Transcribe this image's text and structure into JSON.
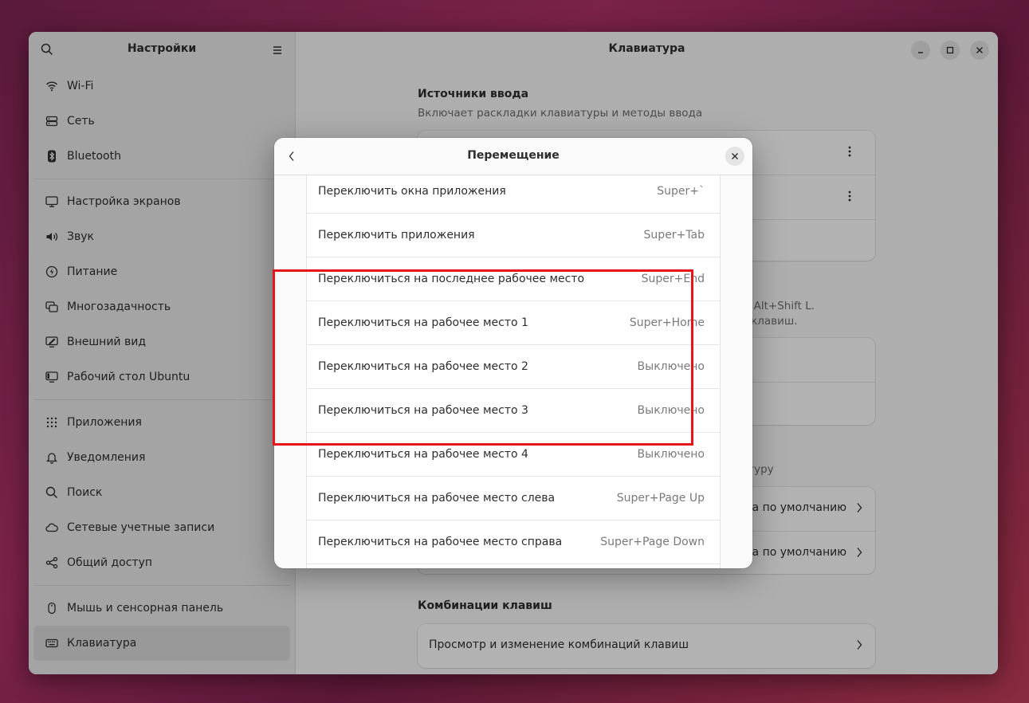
{
  "sidebar": {
    "title": "Настройки",
    "groups": [
      [
        {
          "label": "Wi-Fi",
          "icon": "wifi-icon"
        },
        {
          "label": "Сеть",
          "icon": "network-icon"
        },
        {
          "label": "Bluetooth",
          "icon": "bluetooth-icon"
        }
      ],
      [
        {
          "label": "Настройка экранов",
          "icon": "display-icon"
        },
        {
          "label": "Звук",
          "icon": "speaker-icon"
        },
        {
          "label": "Питание",
          "icon": "power-icon"
        },
        {
          "label": "Многозадачность",
          "icon": "multitasking-icon"
        },
        {
          "label": "Внешний вид",
          "icon": "appearance-icon"
        },
        {
          "label": "Рабочий стол Ubuntu",
          "icon": "ubuntu-desktop-icon"
        }
      ],
      [
        {
          "label": "Приложения",
          "icon": "apps-grid-icon"
        },
        {
          "label": "Уведомления",
          "icon": "bell-icon"
        },
        {
          "label": "Поиск",
          "icon": "search-icon"
        },
        {
          "label": "Сетевые учетные записи",
          "icon": "cloud-icon"
        },
        {
          "label": "Общий доступ",
          "icon": "share-icon"
        }
      ],
      [
        {
          "label": "Мышь и сенсорная панель",
          "icon": "mouse-icon"
        },
        {
          "label": "Клавиатура",
          "icon": "keyboard-icon",
          "active": true
        }
      ]
    ]
  },
  "main": {
    "title": "Клавиатура",
    "input_sources": {
      "title": "Источники ввода",
      "subtitle": "Включает раскладки клавиатуры и методы ввода"
    },
    "switch_partial": {
      "line1": "ш Alt+Shift L.",
      "line2": "й клавиш."
    },
    "special_partial": {
      "text": "атуру",
      "rows": [
        "ка по умолчанию",
        "ка по умолчанию"
      ]
    },
    "shortcuts": {
      "title": "Комбинации клавиш",
      "row": "Просмотр и изменение комбинаций клавиш"
    }
  },
  "dialog": {
    "title": "Перемещение",
    "rows": [
      {
        "label": "Переключить окна приложения",
        "shortcut": "Super+`"
      },
      {
        "label": "Переключить приложения",
        "shortcut": "Super+Tab"
      },
      {
        "label": "Переключиться на последнее рабочее место",
        "shortcut": "Super+End"
      },
      {
        "label": "Переключиться на рабочее место 1",
        "shortcut": "Super+Home"
      },
      {
        "label": "Переключиться на рабочее место 2",
        "shortcut": "Выключено"
      },
      {
        "label": "Переключиться на рабочее место 3",
        "shortcut": "Выключено"
      },
      {
        "label": "Переключиться на рабочее место 4",
        "shortcut": "Выключено"
      },
      {
        "label": "Переключиться на рабочее место слева",
        "shortcut": "Super+Page Up"
      },
      {
        "label": "Переключиться на рабочее место справа",
        "shortcut": "Super+Page Down"
      },
      {
        "label": "",
        "shortcut": ""
      }
    ]
  },
  "colors": {
    "highlight": "#e8141c",
    "wallpaper": "#6a1e40"
  }
}
